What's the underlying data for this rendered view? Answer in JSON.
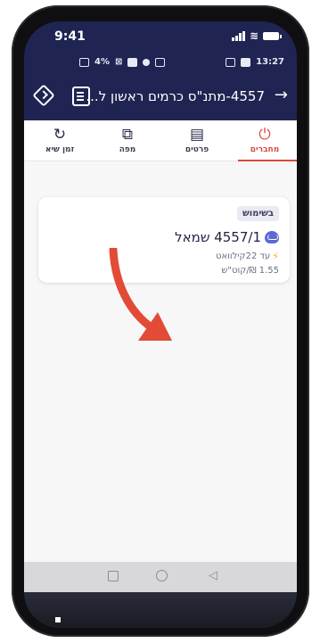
{
  "ios_status": {
    "time": "9:41"
  },
  "android_status": {
    "battery": "4%",
    "time": "13:27"
  },
  "appbar": {
    "title": "4557-מתנ\"ס כרמים ראשון ל...",
    "back_icon": "arrow-right-icon",
    "list_icon": "list-icon",
    "route_icon": "directions-icon"
  },
  "tabs": [
    {
      "label": "מחברים",
      "icon": "plug-icon",
      "active": true
    },
    {
      "label": "פרטים",
      "icon": "clipboard-icon",
      "active": false
    },
    {
      "label": "מפה",
      "icon": "map-icon",
      "active": false
    },
    {
      "label": "זמן שיא",
      "icon": "history-icon",
      "active": false
    }
  ],
  "card": {
    "status_badge": "בשימוש",
    "connector_name": "4557/1 שמאל",
    "power": "עד 22קילוואט",
    "price": "1.55 ₪/קוט\"ש"
  },
  "colors": {
    "accent": "#d84b3a",
    "appbar": "#1f2452",
    "connector": "#5b68d6",
    "bolt": "#f2b01e"
  }
}
